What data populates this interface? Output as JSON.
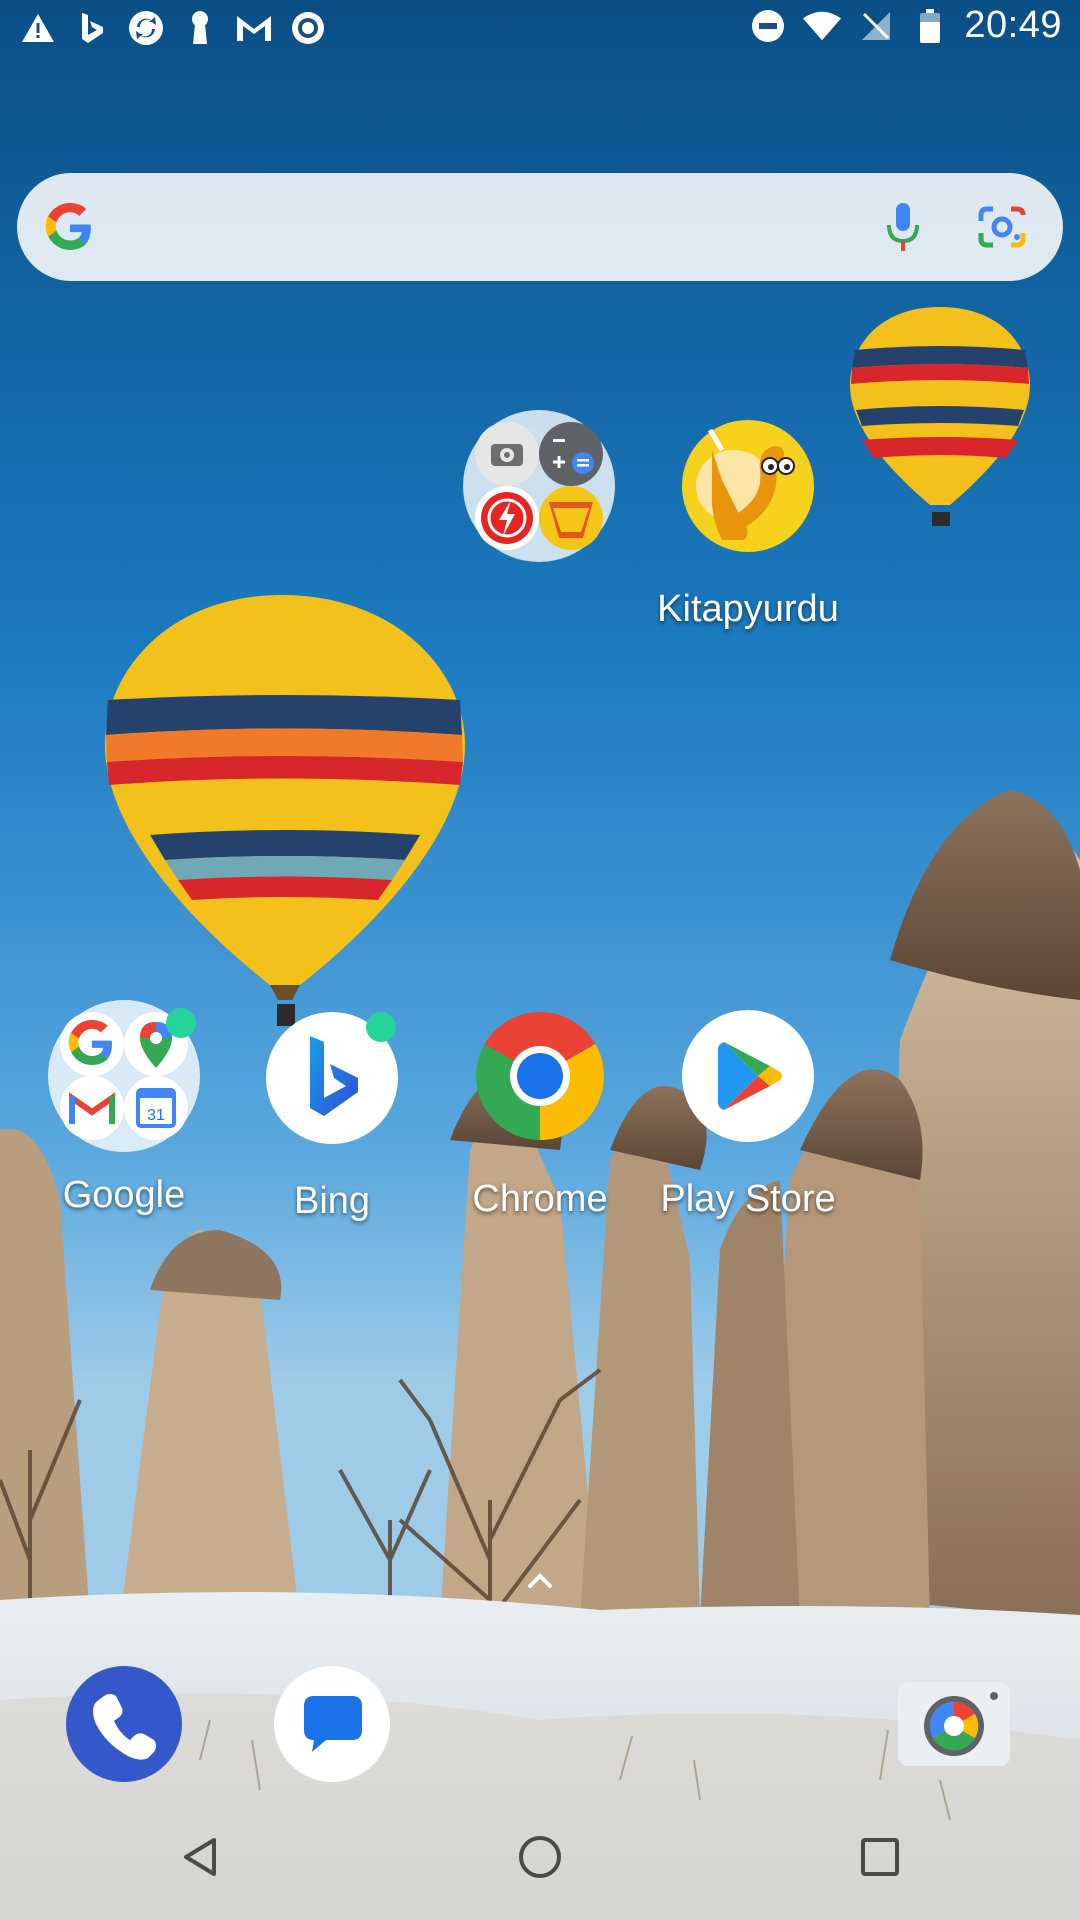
{
  "status_bar": {
    "time": "20:49",
    "left_icons": [
      "warning-icon",
      "bing-icon",
      "sync-icon",
      "keyhole-icon",
      "gmail-icon",
      "record-icon"
    ],
    "right_icons": [
      "do-not-disturb-icon",
      "wifi-icon",
      "no-sim-icon",
      "battery-icon"
    ]
  },
  "search": {
    "logo": "google-g-icon",
    "mic": "microphone-icon",
    "lens": "google-lens-icon"
  },
  "home_apps": {
    "tools_folder": {
      "label": ""
    },
    "kitapyurdu": {
      "label": "Kitapyurdu"
    },
    "google_folder": {
      "label": "Google"
    },
    "bing": {
      "label": "Bing"
    },
    "chrome": {
      "label": "Chrome"
    },
    "play_store": {
      "label": "Play Store"
    }
  },
  "dock": {
    "items": [
      "phone-icon",
      "messages-icon",
      "camera-icon"
    ]
  },
  "nav": {
    "back": "back-triangle-icon",
    "home": "home-circle-icon",
    "recents": "recents-square-icon"
  },
  "colors": {
    "sky_top": "#0a4f86",
    "sky_mid": "#1d7cc2",
    "notification_dot": "#27d39b"
  }
}
